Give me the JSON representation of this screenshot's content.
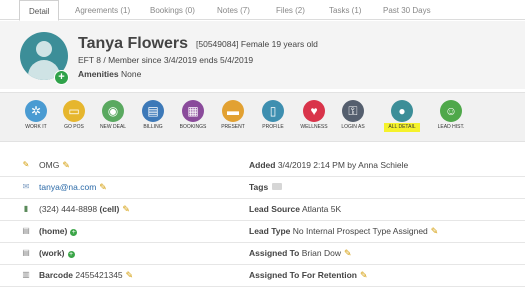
{
  "tabs": [
    "Detail",
    "Agreements (1)",
    "Bookings (0)",
    "Notes (7)",
    "Files (2)",
    "Tasks (1)",
    "Past 30 Days"
  ],
  "profile": {
    "name": "Tanya Flowers",
    "meta": "[50549084]  Female 19 years old",
    "membership": "EFT 8 / Member since 3/4/2019 ends 5/4/2019",
    "amenities_label": "Amenities",
    "amenities_value": "None"
  },
  "toolbar": [
    {
      "label": "WORK IT",
      "icon": "network-icon",
      "color": "#4a9bd2"
    },
    {
      "label": "GO POS",
      "icon": "cart-icon",
      "color": "#e6b62e"
    },
    {
      "label": "NEW DEAL",
      "icon": "deal-icon",
      "color": "#5aa960"
    },
    {
      "label": "BILLING",
      "icon": "billing-icon",
      "color": "#3d79b8"
    },
    {
      "label": "BOOKINGS",
      "icon": "calendar-icon",
      "color": "#8a4b9b"
    },
    {
      "label": "PRESENT",
      "icon": "presentation-icon",
      "color": "#e2a132"
    },
    {
      "label": "PROFILE",
      "icon": "profile-icon",
      "color": "#3e8fb0"
    },
    {
      "label": "WELLNESS",
      "icon": "heart-icon",
      "color": "#d9344a"
    },
    {
      "label": "LOGIN AS",
      "icon": "login-as-icon",
      "color": "#555f6e"
    },
    {
      "label": "ALL DETAIL",
      "icon": "person-icon",
      "color": "#3c8e98"
    },
    {
      "label": "LEAD HIST.",
      "icon": "group-icon",
      "color": "#4fa84a"
    }
  ],
  "details": {
    "note": "OMG",
    "email": "tanya@na.com",
    "phone": "(324) 444-8898",
    "phone_type": "(cell)",
    "home": "(home)",
    "work": "(work)",
    "barcode_label": "Barcode",
    "barcode": "2455421345",
    "added_label": "Added",
    "added": "3/4/2019 2:14 PM by Anna Schiele",
    "tags_label": "Tags",
    "lead_source_label": "Lead Source",
    "lead_source": "Atlanta 5K",
    "lead_type_label": "Lead Type",
    "lead_type": "No Internal Prospect Type Assigned",
    "assigned_to_label": "Assigned To",
    "assigned_to": "Brian Dow",
    "assigned_retention_label": "Assigned To For Retention"
  }
}
